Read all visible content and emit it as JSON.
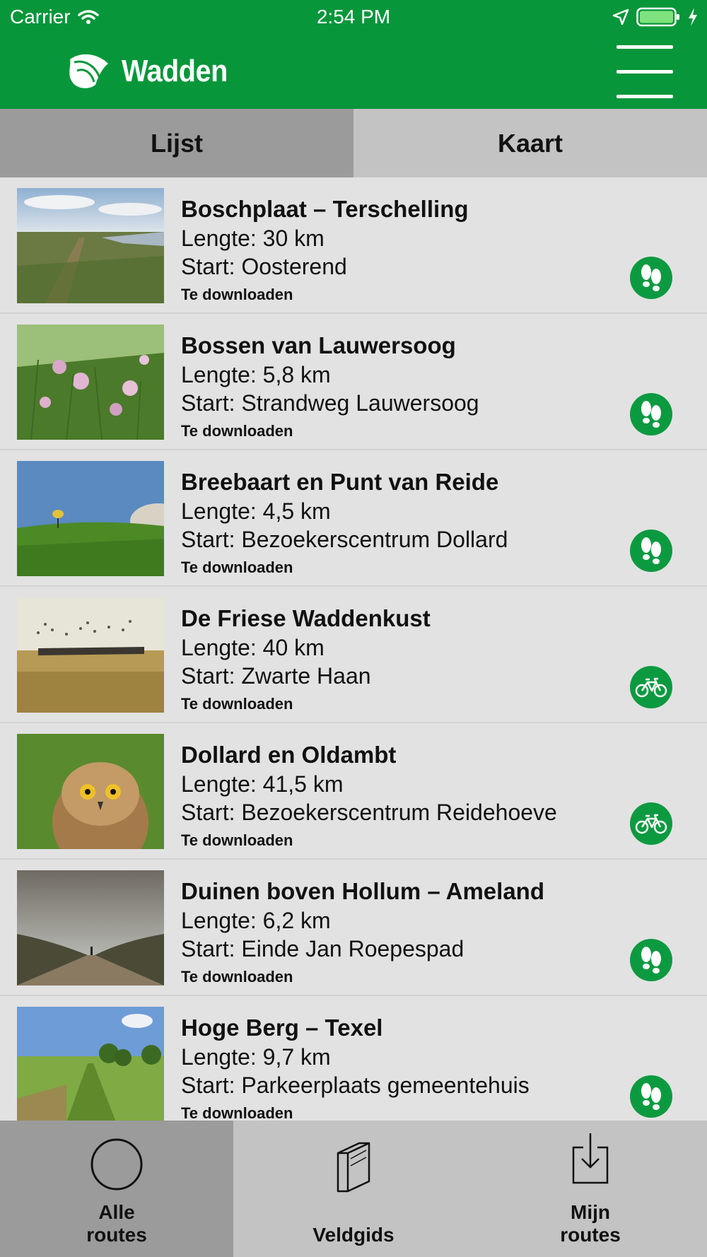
{
  "status_bar": {
    "carrier": "Carrier",
    "time": "2:54 PM",
    "icons": [
      "wifi-icon",
      "location-arrow-icon",
      "battery-icon",
      "charging-bolt-icon"
    ]
  },
  "header": {
    "title": "Wadden",
    "logo_icon": "leaf-logo-icon",
    "menu_icon": "hamburger-menu-icon"
  },
  "segments": [
    {
      "label": "Lijst",
      "selected": true
    },
    {
      "label": "Kaart",
      "selected": false
    }
  ],
  "routes": [
    {
      "name": "Boschplaat – Terschelling",
      "length": "Lengte: 30 km",
      "start": "Start: Oosterend",
      "status": "Te downloaden",
      "type_icon": "footprints-icon"
    },
    {
      "name": "Bossen van Lauwersoog",
      "length": "Lengte: 5,8 km",
      "start": "Start: Strandweg Lauwersoog",
      "status": "Te downloaden",
      "type_icon": "footprints-icon"
    },
    {
      "name": "Breebaart en Punt van Reide",
      "length": "Lengte: 4,5 km",
      "start": "Start: Bezoekerscentrum Dollard",
      "status": "Te downloaden",
      "type_icon": "footprints-icon"
    },
    {
      "name": "De Friese Waddenkust",
      "length": "Lengte: 40 km",
      "start": "Start: Zwarte Haan",
      "status": "Te downloaden",
      "type_icon": "bicycle-icon"
    },
    {
      "name": "Dollard en Oldambt",
      "length": "Lengte: 41,5 km",
      "start": "Start: Bezoekerscentrum Reidehoeve",
      "status": "Te downloaden",
      "type_icon": "bicycle-icon"
    },
    {
      "name": "Duinen boven Hollum – Ameland",
      "length": "Lengte: 6,2 km",
      "start": "Start: Einde Jan Roepespad",
      "status": "Te downloaden",
      "type_icon": "footprints-icon"
    },
    {
      "name": "Hoge Berg – Texel",
      "length": "Lengte: 9,7 km",
      "start": "Start: Parkeerplaats gemeentehuis",
      "status": "Te downloaden",
      "type_icon": "footprints-icon"
    }
  ],
  "tab_bar": [
    {
      "label": "Alle\nroutes",
      "icon": "circle-icon",
      "selected": true
    },
    {
      "label": "Veldgids",
      "icon": "book-icon",
      "selected": false
    },
    {
      "label": "Mijn\nroutes",
      "icon": "download-icon",
      "selected": false
    }
  ],
  "colors": {
    "brand_green": "#07963a",
    "list_background": "#e2e2e2",
    "selected_segment": "#9b9b9b",
    "unselected_segment": "#c3c3c3"
  }
}
